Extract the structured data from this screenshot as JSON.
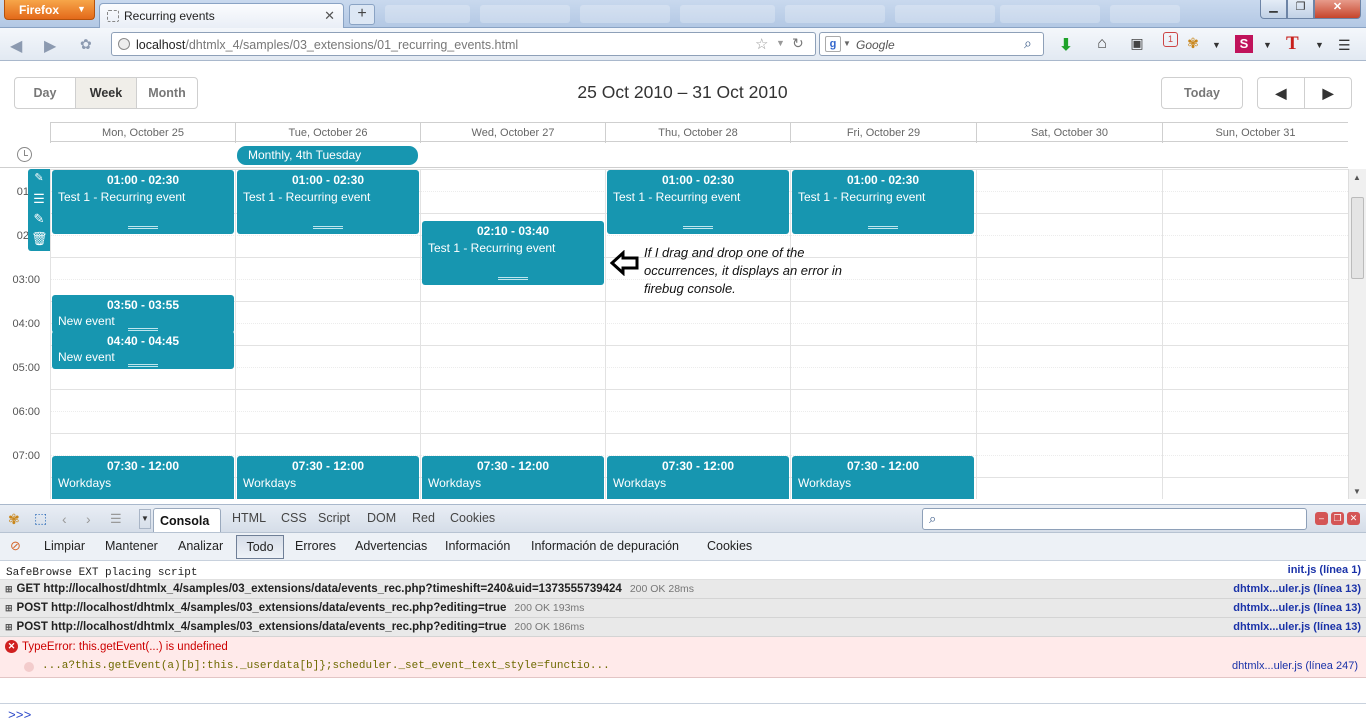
{
  "browser": {
    "menu_button": "Firefox",
    "tab_title": "Recurring events",
    "url_host": "localhost",
    "url_path": "/dhtmlx_4/samples/03_extensions/01_recurring_events.html",
    "search_placeholder": "Google"
  },
  "scheduler": {
    "view_tabs": [
      "Day",
      "Week",
      "Month"
    ],
    "active_view": "Week",
    "date_range": "25 Oct 2010 – 31 Oct 2010",
    "today_label": "Today",
    "days": [
      "Mon, October 25",
      "Tue, October 26",
      "Wed, October 27",
      "Thu, October 28",
      "Fri, October 29",
      "Sat, October 30",
      "Sun, October 31"
    ],
    "hours": [
      "01:",
      "02:",
      "03:00",
      "04:00",
      "05:00",
      "06:00",
      "07:00"
    ],
    "multiday_event": "Monthly, 4th Tuesday",
    "events": [
      {
        "time": "01:00 - 02:30",
        "text": "Test 1 - Recurring event",
        "day": "Mon"
      },
      {
        "time": "01:00 - 02:30",
        "text": "Test 1 - Recurring event",
        "day": "Tue"
      },
      {
        "time": "02:10 - 03:40",
        "text": "Test 1 - Recurring event",
        "day": "Wed"
      },
      {
        "time": "01:00 - 02:30",
        "text": "Test 1 - Recurring event",
        "day": "Thu"
      },
      {
        "time": "01:00 - 02:30",
        "text": "Test 1 - Recurring event",
        "day": "Fri"
      },
      {
        "time": "03:50 - 03:55",
        "text": "New event",
        "day": "Mon"
      },
      {
        "time": "04:40 - 04:45",
        "text": "New event",
        "day": "Mon"
      },
      {
        "time": "07:30 - 12:00",
        "text": "Workdays",
        "day": "Mon"
      },
      {
        "time": "07:30 - 12:00",
        "text": "Workdays",
        "day": "Tue"
      },
      {
        "time": "07:30 - 12:00",
        "text": "Workdays",
        "day": "Wed"
      },
      {
        "time": "07:30 - 12:00",
        "text": "Workdays",
        "day": "Thu"
      },
      {
        "time": "07:30 - 12:00",
        "text": "Workdays",
        "day": "Fri"
      }
    ]
  },
  "annotation": "If I drag and drop one of the occurrences, it displays an error in firebug console.",
  "firebug": {
    "tabs": [
      "Consola",
      "HTML",
      "CSS",
      "Script",
      "DOM",
      "Red",
      "Cookies"
    ],
    "active_tab": "Consola",
    "filters": [
      "Limpiar",
      "Mantener",
      "Analizar",
      "Todo",
      "Errores",
      "Advertencias",
      "Información",
      "Información de depuración",
      "Cookies"
    ],
    "active_filter": "Todo",
    "log": {
      "info": {
        "text": "SafeBrowse EXT placing script",
        "src": "init.js (línea 1)"
      },
      "net": [
        {
          "text": "GET http://localhost/dhtmlx_4/samples/03_extensions/data/events_rec.php?timeshift=240&uid=1373555739424",
          "status": "200 OK 28ms",
          "src": "dhtmlx...uler.js (línea 13)"
        },
        {
          "text": "POST http://localhost/dhtmlx_4/samples/03_extensions/data/events_rec.php?editing=true",
          "status": "200 OK 193ms",
          "src": "dhtmlx...uler.js (línea 13)"
        },
        {
          "text": "POST http://localhost/dhtmlx_4/samples/03_extensions/data/events_rec.php?editing=true",
          "status": "200 OK 186ms",
          "src": "dhtmlx...uler.js (línea 13)"
        }
      ],
      "error": {
        "text": "TypeError: this.getEvent(...) is undefined",
        "code": "...a?this.getEvent(a)[b]:this._userdata[b]};scheduler._set_event_text_style=functio...",
        "src": "dhtmlx...uler.js (línea 247)"
      }
    },
    "cmd_prompt": ">>>"
  },
  "colors": {
    "event": "#1796b0",
    "error_bg": "#ffeaea",
    "link": "#1a32a8"
  }
}
